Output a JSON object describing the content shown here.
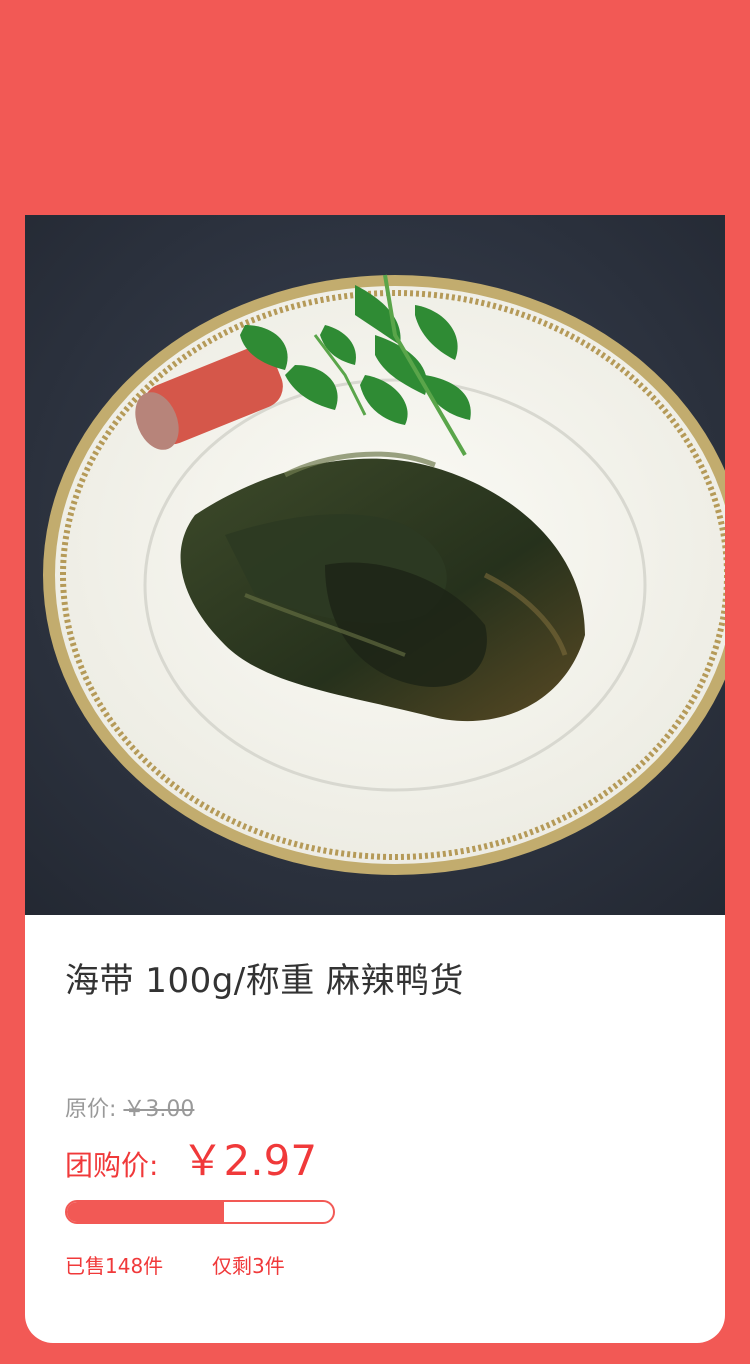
{
  "product": {
    "title": "海带 100g/称重 麻辣鸭货",
    "image_alt": "海带 麻辣鸭货 product photo"
  },
  "pricing": {
    "original_label": "原价:",
    "original_value": "￥3.00",
    "group_label": "团购价:",
    "group_value": "￥2.97"
  },
  "progress": {
    "fraction": 0.59
  },
  "stock": {
    "sold_text": "已售148件",
    "remaining_text": "仅剩3件"
  },
  "colors": {
    "background": "#f25955",
    "accent": "#f0393a",
    "card": "#ffffff"
  }
}
